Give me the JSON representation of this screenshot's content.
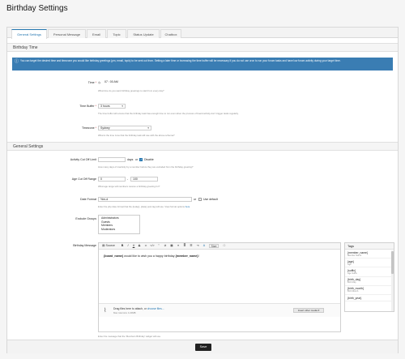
{
  "page": {
    "title": "Birthday Settings"
  },
  "tabs": [
    {
      "label": "General Settings"
    },
    {
      "label": "Personal Message"
    },
    {
      "label": "Email"
    },
    {
      "label": "Topic"
    },
    {
      "label": "Status Update"
    },
    {
      "label": "Chatbox"
    }
  ],
  "sections": {
    "birthday_time": "Birthday Time",
    "general": "General Settings"
  },
  "notice": "You can target the desired time and timezone you would like birthday greetings (pm, email, topic) to be sent out from. Setting a later time or increasing the time buffer will be necessary if you do not use cron to run your forum tasks and have low forum activity during your target time.",
  "fields": {
    "time": {
      "label": "Time",
      "required": "*",
      "value": "07 : 00  AM",
      "hint": "What time do you want birthday greetings to start from every day?"
    },
    "time_buffer": {
      "label": "Time Buffer",
      "required": "*",
      "value": "3 hours",
      "hint": "The time buffer will ensure that the birthday task has enough time to run even when the process of board activity don't trigger tasks regularly."
    },
    "timezone": {
      "label": "Timezone",
      "required": "*",
      "value": "Sydney",
      "hint": "What is the time zone that the birthday task will use with the above schema?"
    },
    "activity_cutoff": {
      "label": "Activity Cut Off Limit",
      "value": "",
      "unit": "days",
      "or": "or",
      "disable_label": "Disable",
      "hint": "How many days of inactivity by a member before they are excluded from the birthday greeting?"
    },
    "age_cutoff": {
      "label": "Age Cut Off Range",
      "min": "0",
      "max": "100",
      "hint": "What age range will members receive a birthday greeting for?"
    },
    "date_format": {
      "label": "Date Format",
      "value": "%m-d",
      "custom": "or",
      "use_default": "Use default",
      "hint": "Enter the php date format that the {today}, {date} post tag will use. View format options",
      "hint_link": "here"
    },
    "exclude_groups": {
      "label": "Exclude Groups",
      "options": [
        "Administrators",
        "Guests",
        "Members",
        "Moderators"
      ]
    },
    "birthday_message": {
      "label": "Birthday Message",
      "content_tag_1": "{board_name}",
      "content_text": " would like to wish you a happy birthday ",
      "content_tag_2": "{member_name}",
      "content_end": "!",
      "hint": "Enter the message that the 'Members Birthday' widget will use."
    }
  },
  "toolbar": {
    "source": "Source",
    "bold": "B",
    "italic": "I",
    "underline": "U",
    "strike": "S",
    "link": "∞",
    "code": "</>",
    "quote": "”",
    "spoiler": "⊘",
    "table": "▦",
    "bullets": "≡",
    "numbered": "≣",
    "align": "☰",
    "indent": "⇥",
    "color": "A",
    "size": "Size",
    "preview": "□"
  },
  "attachments": {
    "text": "Drag files here to attach, or",
    "link": "choose files...",
    "sub": "Max total size 4.20MB",
    "insert_button": "Insert other media ▾"
  },
  "tags": {
    "title": "Tags",
    "items": [
      {
        "name": "{member_name}",
        "desc": "Member Name"
      },
      {
        "name": "{age}",
        "desc": "Age"
      },
      {
        "name": "{suffix}",
        "desc": "Age Suffix"
      },
      {
        "name": "{birth_day}",
        "desc": "Birth Day"
      },
      {
        "name": "{birth_month}",
        "desc": "Birth Month"
      },
      {
        "name": "{birth_year}",
        "desc": ""
      }
    ]
  },
  "footer": {
    "save": "Save"
  },
  "colors": {
    "accent": "#2577b1",
    "notice_bg": "#3a7db3",
    "save_bg": "#222222"
  }
}
